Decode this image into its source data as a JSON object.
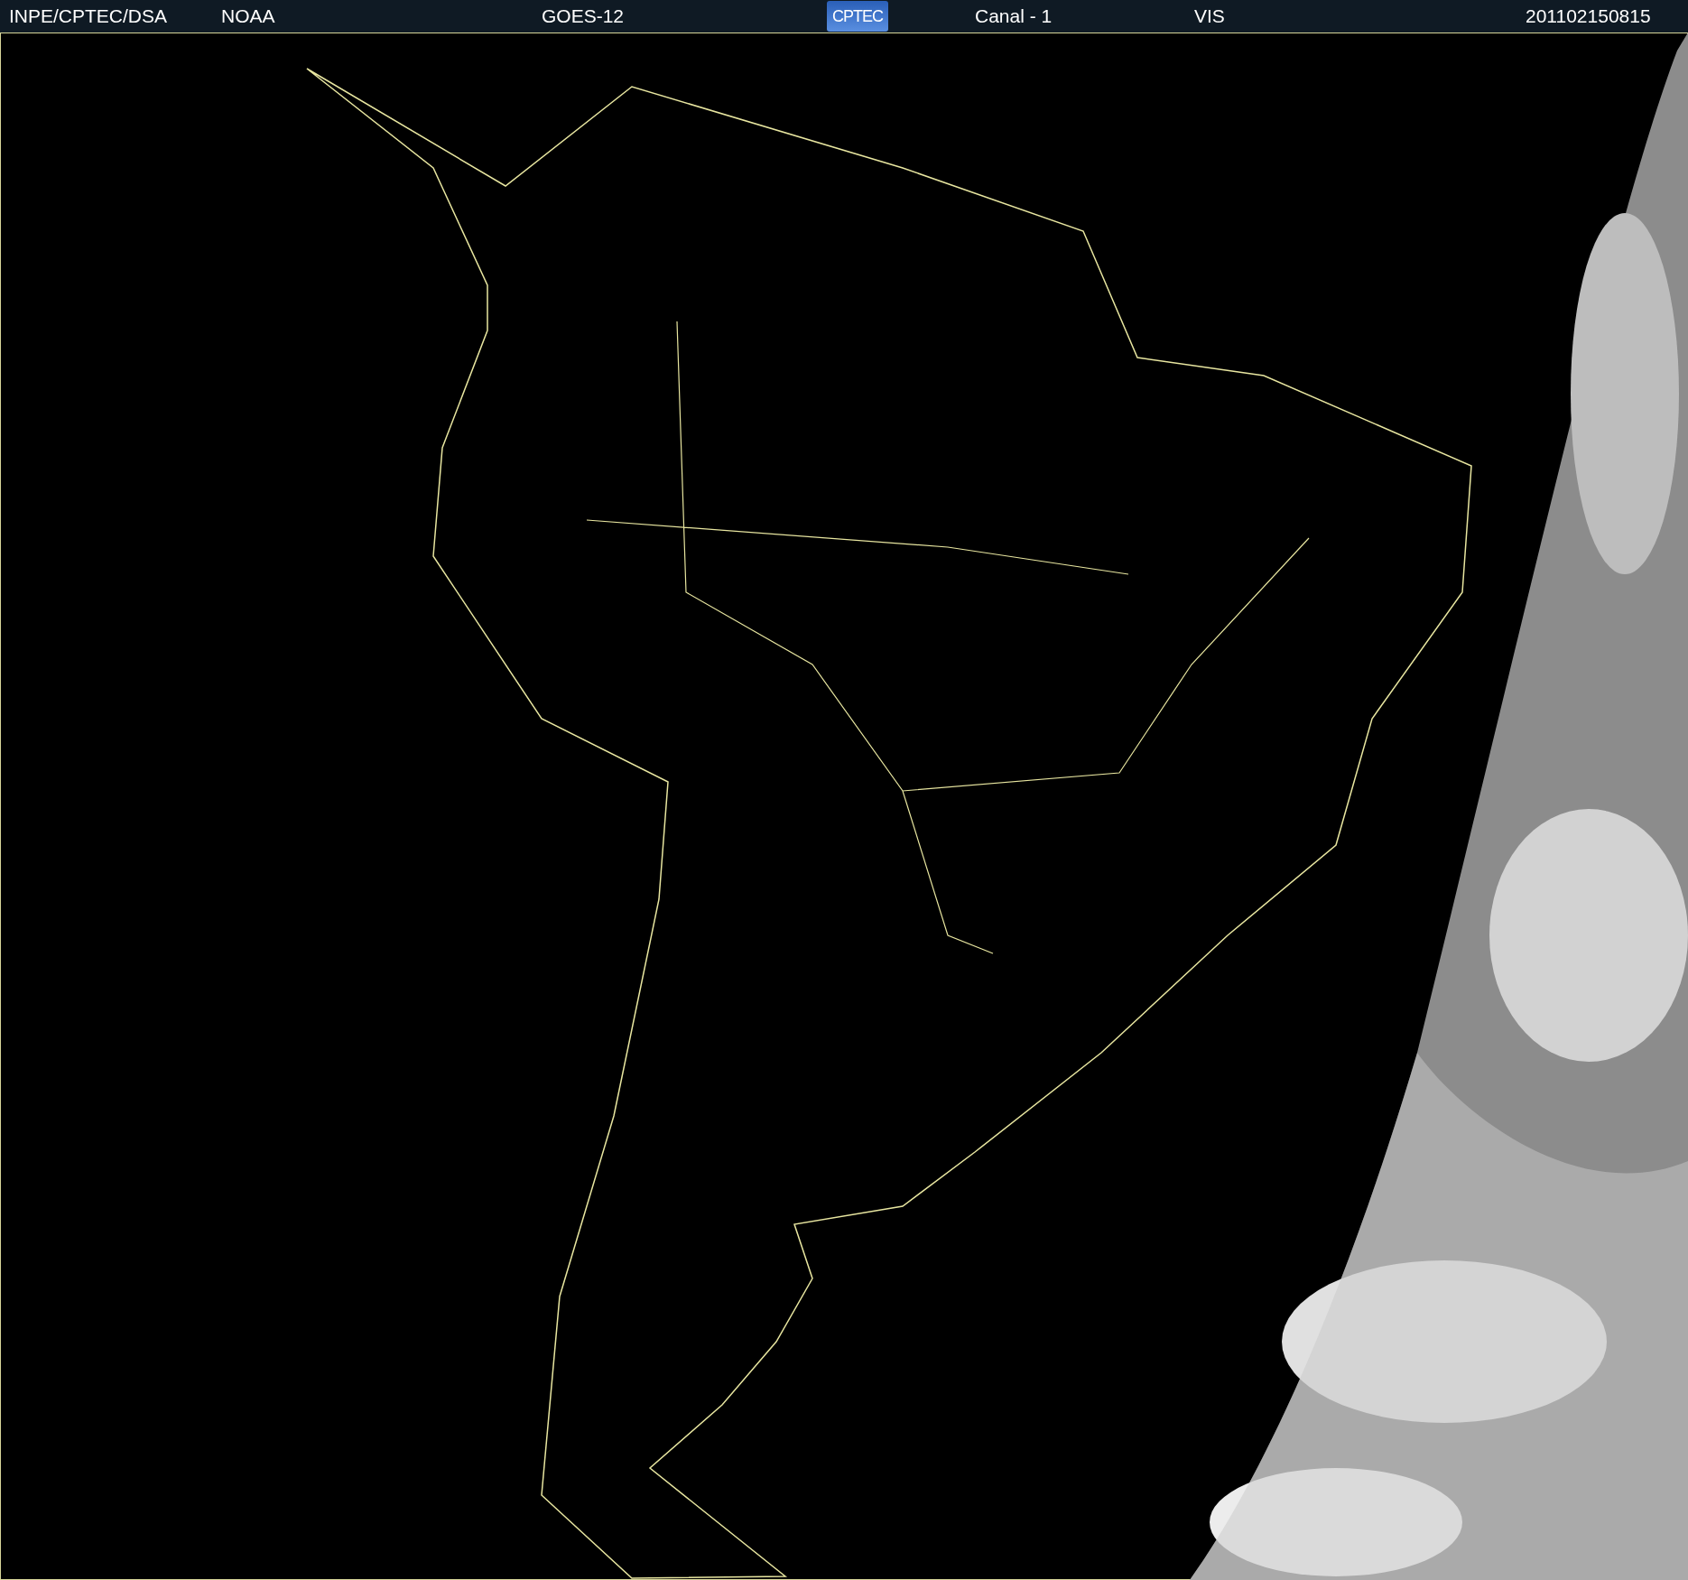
{
  "header": {
    "items": [
      {
        "kind": "text",
        "label": "INPE/CPTEC/DSA"
      },
      {
        "kind": "text",
        "label": "NOAA"
      },
      {
        "kind": "text",
        "label": "GOES-12"
      },
      {
        "kind": "logo",
        "label": "CPTEC"
      },
      {
        "kind": "text",
        "label": "Canal - 1"
      },
      {
        "kind": "text",
        "label": "VIS"
      },
      {
        "kind": "text",
        "label": "201102150815"
      }
    ]
  }
}
